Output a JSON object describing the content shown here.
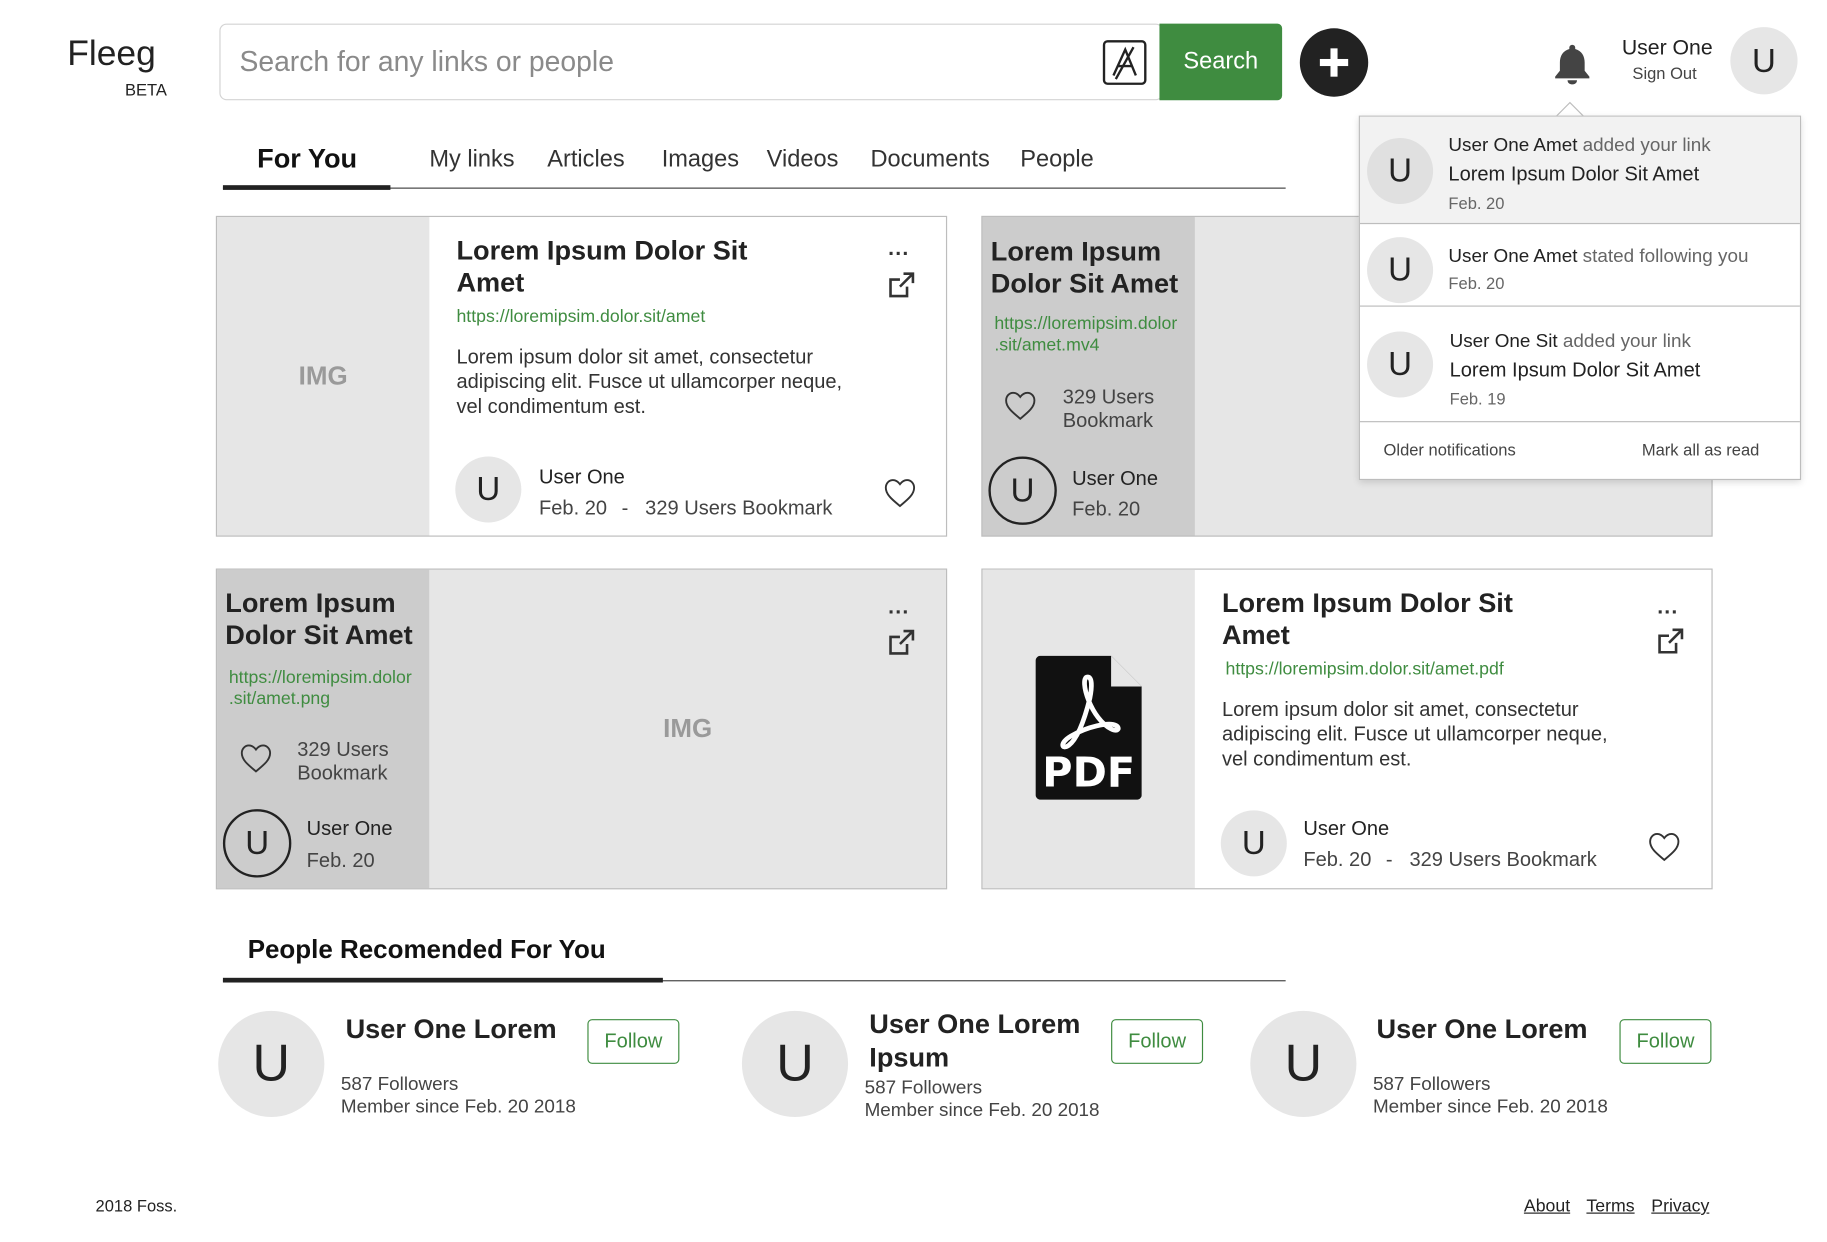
{
  "header": {
    "logo": "Fleeg",
    "beta": "BETA",
    "search_placeholder": "Search for any links or people",
    "search_button": "Search",
    "user_name": "User One",
    "sign_out": "Sign Out",
    "avatar_initial": "U"
  },
  "tabs": [
    {
      "label": "For You"
    },
    {
      "label": "My links"
    },
    {
      "label": "Articles"
    },
    {
      "label": "Images"
    },
    {
      "label": "Videos"
    },
    {
      "label": "Documents"
    },
    {
      "label": "People"
    }
  ],
  "cards": [
    {
      "img": "IMG",
      "title_l1": "Lorem Ipsum Dolor Sit",
      "title_l2": "Amet",
      "url": "https://loremipsim.dolor.sit/amet",
      "desc_l1": "Lorem ipsum dolor sit amet, consectetur",
      "desc_l2": "adipiscing elit. Fusce ut ullamcorper neque,",
      "desc_l3": "vel condimentum est.",
      "user": "User One",
      "date": "Feb. 20",
      "sep": "-",
      "bookmarks": "329 Users Bookmark",
      "avatar": "U",
      "dots": "..."
    },
    {
      "title_l1": "Lorem Ipsum",
      "title_l2": "Dolor Sit Amet",
      "url_l1": "https://loremipsim.dolor",
      "url_l2": ".sit/amet.mv4",
      "bm_l1": "329 Users",
      "bm_l2": "Bookmark",
      "user": "User One",
      "date": "Feb. 20",
      "avatar": "U"
    },
    {
      "img": "IMG",
      "title_l1": "Lorem Ipsum",
      "title_l2": "Dolor Sit Amet",
      "url_l1": "https://loremipsim.dolor",
      "url_l2": ".sit/amet.png",
      "bm_l1": "329 Users",
      "bm_l2": "Bookmark",
      "user": "User One",
      "date": "Feb. 20",
      "avatar": "U",
      "dots": "..."
    },
    {
      "title_l1": "Lorem Ipsum Dolor Sit",
      "title_l2": "Amet",
      "url": "https://loremipsim.dolor.sit/amet.pdf",
      "desc_l1": "Lorem ipsum dolor sit amet, consectetur",
      "desc_l2": "adipiscing elit. Fusce ut ullamcorper neque,",
      "desc_l3": "vel condimentum est.",
      "user": "User One",
      "date": "Feb. 20",
      "sep": "-",
      "bookmarks": "329 Users Bookmark",
      "avatar": "U",
      "dots": "...",
      "pdf_label": "PDF"
    }
  ],
  "notifications": {
    "items": [
      {
        "avatar": "U",
        "actor": "User One Amet",
        "action": "added your link",
        "link": "Lorem Ipsum Dolor Sit Amet",
        "date": "Feb. 20"
      },
      {
        "avatar": "U",
        "actor": "User One Amet",
        "action": "stated following you",
        "date": "Feb. 20"
      },
      {
        "avatar": "U",
        "actor": "User One Sit",
        "action": "added your link",
        "link": "Lorem Ipsum Dolor Sit Amet",
        "date": "Feb. 19"
      }
    ],
    "older": "Older notifications",
    "mark_read": "Mark all as read"
  },
  "recommended": {
    "title": "People Recomended For You",
    "people": [
      {
        "avatar": "U",
        "name_l1": "User One Lorem",
        "name_l2": "",
        "followers": "587 Followers",
        "since": "Member since Feb. 20  2018",
        "follow": "Follow"
      },
      {
        "avatar": "U",
        "name_l1": "User One Lorem",
        "name_l2": "Ipsum",
        "followers": "587 Followers",
        "since": "Member since Feb. 20  2018",
        "follow": "Follow"
      },
      {
        "avatar": "U",
        "name_l1": "User One Lorem",
        "name_l2": "",
        "followers": "587 Followers",
        "since": "Member since Feb. 20  2018",
        "follow": "Follow"
      }
    ]
  },
  "footer": {
    "copyright": "2018 Foss.",
    "links": [
      "About",
      "Terms",
      "Privacy"
    ]
  },
  "colors": {
    "accent": "#3f8c40",
    "panel_gray": "#e6e6e6",
    "panel_dark": "#cccccc"
  },
  "icons": [
    "ax-icon",
    "plus-icon",
    "bell-icon",
    "external-link-icon",
    "heart-icon",
    "pdf-icon"
  ]
}
